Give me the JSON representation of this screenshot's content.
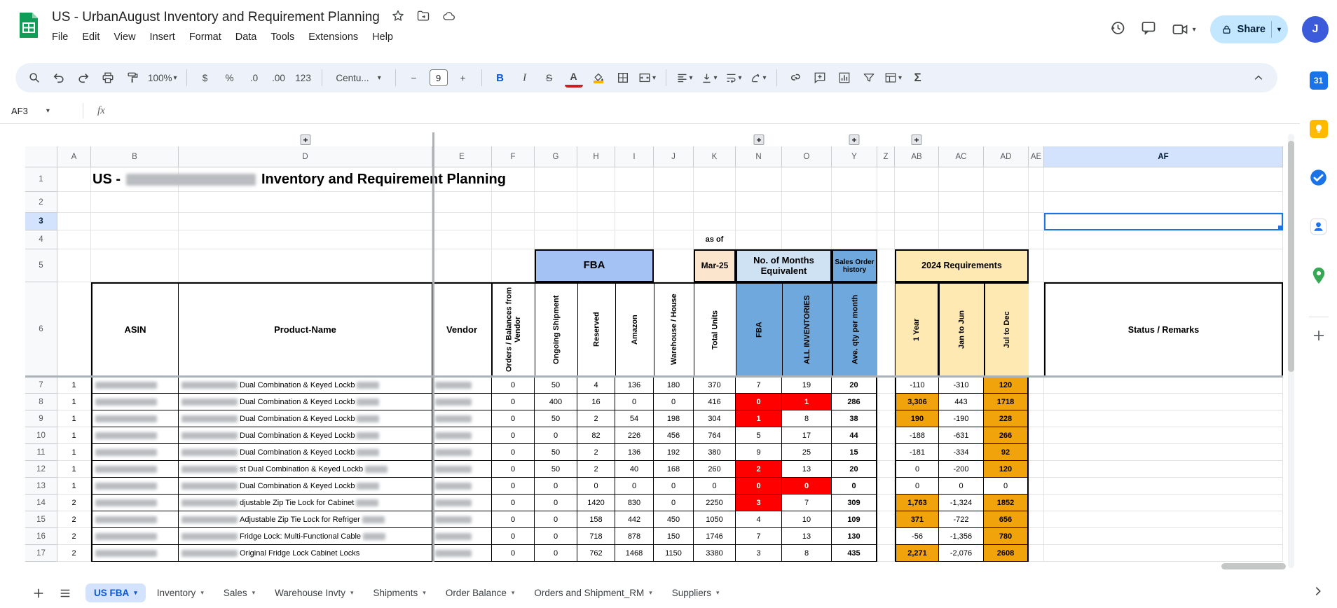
{
  "app": {
    "doc_title": "US - UrbanAugust Inventory and Requirement Planning",
    "menus": [
      "File",
      "Edit",
      "View",
      "Insert",
      "Format",
      "Data",
      "Tools",
      "Extensions",
      "Help"
    ],
    "share_label": "Share",
    "avatar_initial": "J"
  },
  "toolbar": {
    "zoom_value": "100%",
    "currency_label": "$",
    "percent_label": "%",
    "decrease_decimal_label": ".0",
    "increase_decimal_label": ".00",
    "number_format_label": "123",
    "font_value": "Centu...",
    "minus_label": "−",
    "font_size_value": "9",
    "plus_label": "+",
    "bold_label": "B",
    "italic_label": "I",
    "strikethrough_label": "S",
    "text_color_label": "A",
    "sigma_label": "Σ"
  },
  "formula_bar": {
    "cell_reference": "AF3",
    "fx_label": "fx"
  },
  "grid": {
    "column_letters": [
      "A",
      "B",
      "D",
      "E",
      "F",
      "G",
      "H",
      "I",
      "J",
      "K",
      "N",
      "O",
      "Y",
      "Z",
      "AB",
      "AC",
      "AD",
      "AE",
      "AF"
    ],
    "selected_column": "AF",
    "selected_row": "3",
    "title_prefix": "US -",
    "title_suffix": "Inventory and Requirement Planning",
    "as_of_label": "as of",
    "banners": {
      "fba": "FBA",
      "month": "Mar-25",
      "months_equivalent": "No. of Months Equivalent",
      "sales_order_history": "Sales Order history",
      "requirements": "2024 Requirements"
    },
    "headers": {
      "asin": "ASIN",
      "product": "Product-Name",
      "vendor": "Vendor",
      "orders_balances": "Orders / Balances from Vendor",
      "ongoing_shipment": "Ongoing Shipment",
      "reserved": "Reserved",
      "amazon": "Amazon",
      "warehouse": "Warehouse / House",
      "total_units": "Total Units",
      "fba": "FBA",
      "all_inventories": "ALL INVENTORIES",
      "avg_qty": "Ave. qty per month",
      "one_year": "1 Year",
      "jan_jun": "Jan to Jun",
      "jul_dec": "Jul to Dec",
      "status": "Status / Remarks"
    },
    "rows": [
      {
        "row": "7",
        "group": "1",
        "product": "Dual Combination & Keyed Lockb",
        "trail_blur": true,
        "values": {
          "f": "0",
          "g": "50",
          "h": "4",
          "i": "136",
          "j": "180",
          "k": "370",
          "n": "7",
          "o": "19",
          "y": "20",
          "ab": "-110",
          "ac": "-310",
          "ad": "120"
        },
        "highlight": {
          "n": "",
          "o": "",
          "ab": "",
          "ad": "orange"
        }
      },
      {
        "row": "8",
        "group": "1",
        "product": "Dual Combination & Keyed Lockb",
        "trail_blur": true,
        "values": {
          "f": "0",
          "g": "400",
          "h": "16",
          "i": "0",
          "j": "0",
          "k": "416",
          "n": "0",
          "o": "1",
          "y": "286",
          "ab": "3,306",
          "ac": "443",
          "ad": "1718"
        },
        "highlight": {
          "n": "red",
          "o": "red",
          "ab": "orange",
          "ad": "orange"
        }
      },
      {
        "row": "9",
        "group": "1",
        "product": "Dual Combination & Keyed Lockb",
        "trail_blur": true,
        "values": {
          "f": "0",
          "g": "50",
          "h": "2",
          "i": "54",
          "j": "198",
          "k": "304",
          "n": "1",
          "o": "8",
          "y": "38",
          "ab": "190",
          "ac": "-190",
          "ad": "228"
        },
        "highlight": {
          "n": "red",
          "o": "",
          "ab": "orange",
          "ad": "orange"
        }
      },
      {
        "row": "10",
        "group": "1",
        "product": "Dual Combination & Keyed Lockb",
        "trail_blur": true,
        "values": {
          "f": "0",
          "g": "0",
          "h": "82",
          "i": "226",
          "j": "456",
          "k": "764",
          "n": "5",
          "o": "17",
          "y": "44",
          "ab": "-188",
          "ac": "-631",
          "ad": "266"
        },
        "highlight": {
          "n": "",
          "o": "",
          "ab": "",
          "ad": "orange"
        }
      },
      {
        "row": "11",
        "group": "1",
        "product": "Dual Combination & Keyed Lockb",
        "trail_blur": true,
        "values": {
          "f": "0",
          "g": "50",
          "h": "2",
          "i": "136",
          "j": "192",
          "k": "380",
          "n": "9",
          "o": "25",
          "y": "15",
          "ab": "-181",
          "ac": "-334",
          "ad": "92"
        },
        "highlight": {
          "n": "",
          "o": "",
          "ab": "",
          "ad": "orange"
        }
      },
      {
        "row": "12",
        "group": "1",
        "product": "st Dual Combination & Keyed Lockb",
        "trail_blur": true,
        "values": {
          "f": "0",
          "g": "50",
          "h": "2",
          "i": "40",
          "j": "168",
          "k": "260",
          "n": "2",
          "o": "13",
          "y": "20",
          "ab": "0",
          "ac": "-200",
          "ad": "120"
        },
        "highlight": {
          "n": "red",
          "o": "",
          "ab": "",
          "ad": "orange"
        }
      },
      {
        "row": "13",
        "group": "1",
        "product": "Dual Combination & Keyed Lockb",
        "trail_blur": true,
        "values": {
          "f": "0",
          "g": "0",
          "h": "0",
          "i": "0",
          "j": "0",
          "k": "0",
          "n": "0",
          "o": "0",
          "y": "0",
          "ab": "0",
          "ac": "0",
          "ad": "0"
        },
        "highlight": {
          "n": "red",
          "o": "red",
          "ab": "",
          "ad": ""
        }
      },
      {
        "row": "14",
        "group": "2",
        "product": "djustable Zip Tie Lock for Cabinet",
        "trail_blur": true,
        "values": {
          "f": "0",
          "g": "0",
          "h": "1420",
          "i": "830",
          "j": "0",
          "k": "2250",
          "n": "3",
          "o": "7",
          "y": "309",
          "ab": "1,763",
          "ac": "-1,324",
          "ad": "1852"
        },
        "highlight": {
          "n": "red",
          "o": "",
          "ab": "orange",
          "ad": "orange"
        }
      },
      {
        "row": "15",
        "group": "2",
        "product": "Adjustable Zip Tie Lock for Refriger",
        "trail_blur": true,
        "values": {
          "f": "0",
          "g": "0",
          "h": "158",
          "i": "442",
          "j": "450",
          "k": "1050",
          "n": "4",
          "o": "10",
          "y": "109",
          "ab": "371",
          "ac": "-722",
          "ad": "656"
        },
        "highlight": {
          "n": "",
          "o": "",
          "ab": "orange",
          "ad": "orange"
        }
      },
      {
        "row": "16",
        "group": "2",
        "product": "Fridge Lock: Multi-Functional Cable",
        "trail_blur": true,
        "values": {
          "f": "0",
          "g": "0",
          "h": "718",
          "i": "878",
          "j": "150",
          "k": "1746",
          "n": "7",
          "o": "13",
          "y": "130",
          "ab": "-56",
          "ac": "-1,356",
          "ad": "780"
        },
        "highlight": {
          "n": "",
          "o": "",
          "ab": "",
          "ad": "orange"
        }
      },
      {
        "row": "17",
        "group": "2",
        "product": "Original Fridge Lock Cabinet Locks",
        "trail_blur": false,
        "values": {
          "f": "0",
          "g": "0",
          "h": "762",
          "i": "1468",
          "j": "1150",
          "k": "3380",
          "n": "3",
          "o": "8",
          "y": "435",
          "ab": "2,271",
          "ac": "-2,076",
          "ad": "2608"
        },
        "highlight": {
          "n": "",
          "o": "",
          "ab": "orange",
          "ad": "orange"
        }
      }
    ]
  },
  "sheet_tabs": {
    "active": "US FBA",
    "tabs": [
      "US FBA",
      "Inventory",
      "Sales",
      "Warehouse Invty",
      "Shipments",
      "Order Balance",
      "Orders and Shipment_RM",
      "Suppliers"
    ]
  },
  "side_panel": {
    "calendar_label": "31"
  },
  "colors": {
    "accent_blue": "#1a73e8",
    "active_tab_text": "#0b57d0",
    "selection_header_bg": "#d3e3fd",
    "banner_blue": "#a4c2f4",
    "deep_blue": "#6fa8dc",
    "light_blue": "#cfe2f3",
    "tan": "#ffe9b3",
    "peach": "#fce5cd",
    "alert_red": "#ff0000",
    "warn_orange": "#f0a30a",
    "share_pill_bg": "#c2e7ff",
    "toolbar_bg": "#edf2fa",
    "sheets_green": "#0f9d58"
  }
}
